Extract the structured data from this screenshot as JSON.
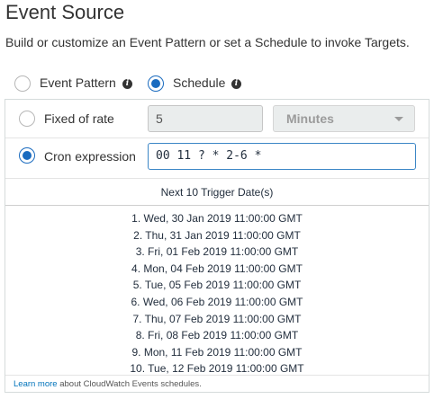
{
  "header": {
    "title": "Event Source",
    "subtitle": "Build or customize an Event Pattern or set a Schedule to invoke Targets."
  },
  "source_type": {
    "event_pattern_label": "Event Pattern",
    "schedule_label": "Schedule",
    "selected": "Schedule"
  },
  "schedule": {
    "fixed_rate_label": "Fixed of rate",
    "fixed_rate_value": "5",
    "fixed_rate_unit": "Minutes",
    "cron_label": "Cron expression",
    "cron_value": "00 11 ? * 2-6 *",
    "selected": "Cron expression"
  },
  "next_triggers": {
    "header": "Next 10 Trigger Date(s)",
    "dates": [
      "1. Wed, 30 Jan 2019 11:00:00 GMT",
      "2. Thu, 31 Jan 2019 11:00:00 GMT",
      "3. Fri, 01 Feb 2019 11:00:00 GMT",
      "4. Mon, 04 Feb 2019 11:00:00 GMT",
      "5. Tue, 05 Feb 2019 11:00:00 GMT",
      "6. Wed, 06 Feb 2019 11:00:00 GMT",
      "7. Thu, 07 Feb 2019 11:00:00 GMT",
      "8. Fri, 08 Feb 2019 11:00:00 GMT",
      "9. Mon, 11 Feb 2019 11:00:00 GMT",
      "10. Tue, 12 Feb 2019 11:00:00 GMT"
    ]
  },
  "footer": {
    "link_text": "Learn more",
    "text": " about CloudWatch Events schedules."
  },
  "icons": {
    "info": "info-icon",
    "dropdown": "caret-down-icon"
  },
  "colors": {
    "accent": "#1a6bbf",
    "link": "#0073bb"
  }
}
